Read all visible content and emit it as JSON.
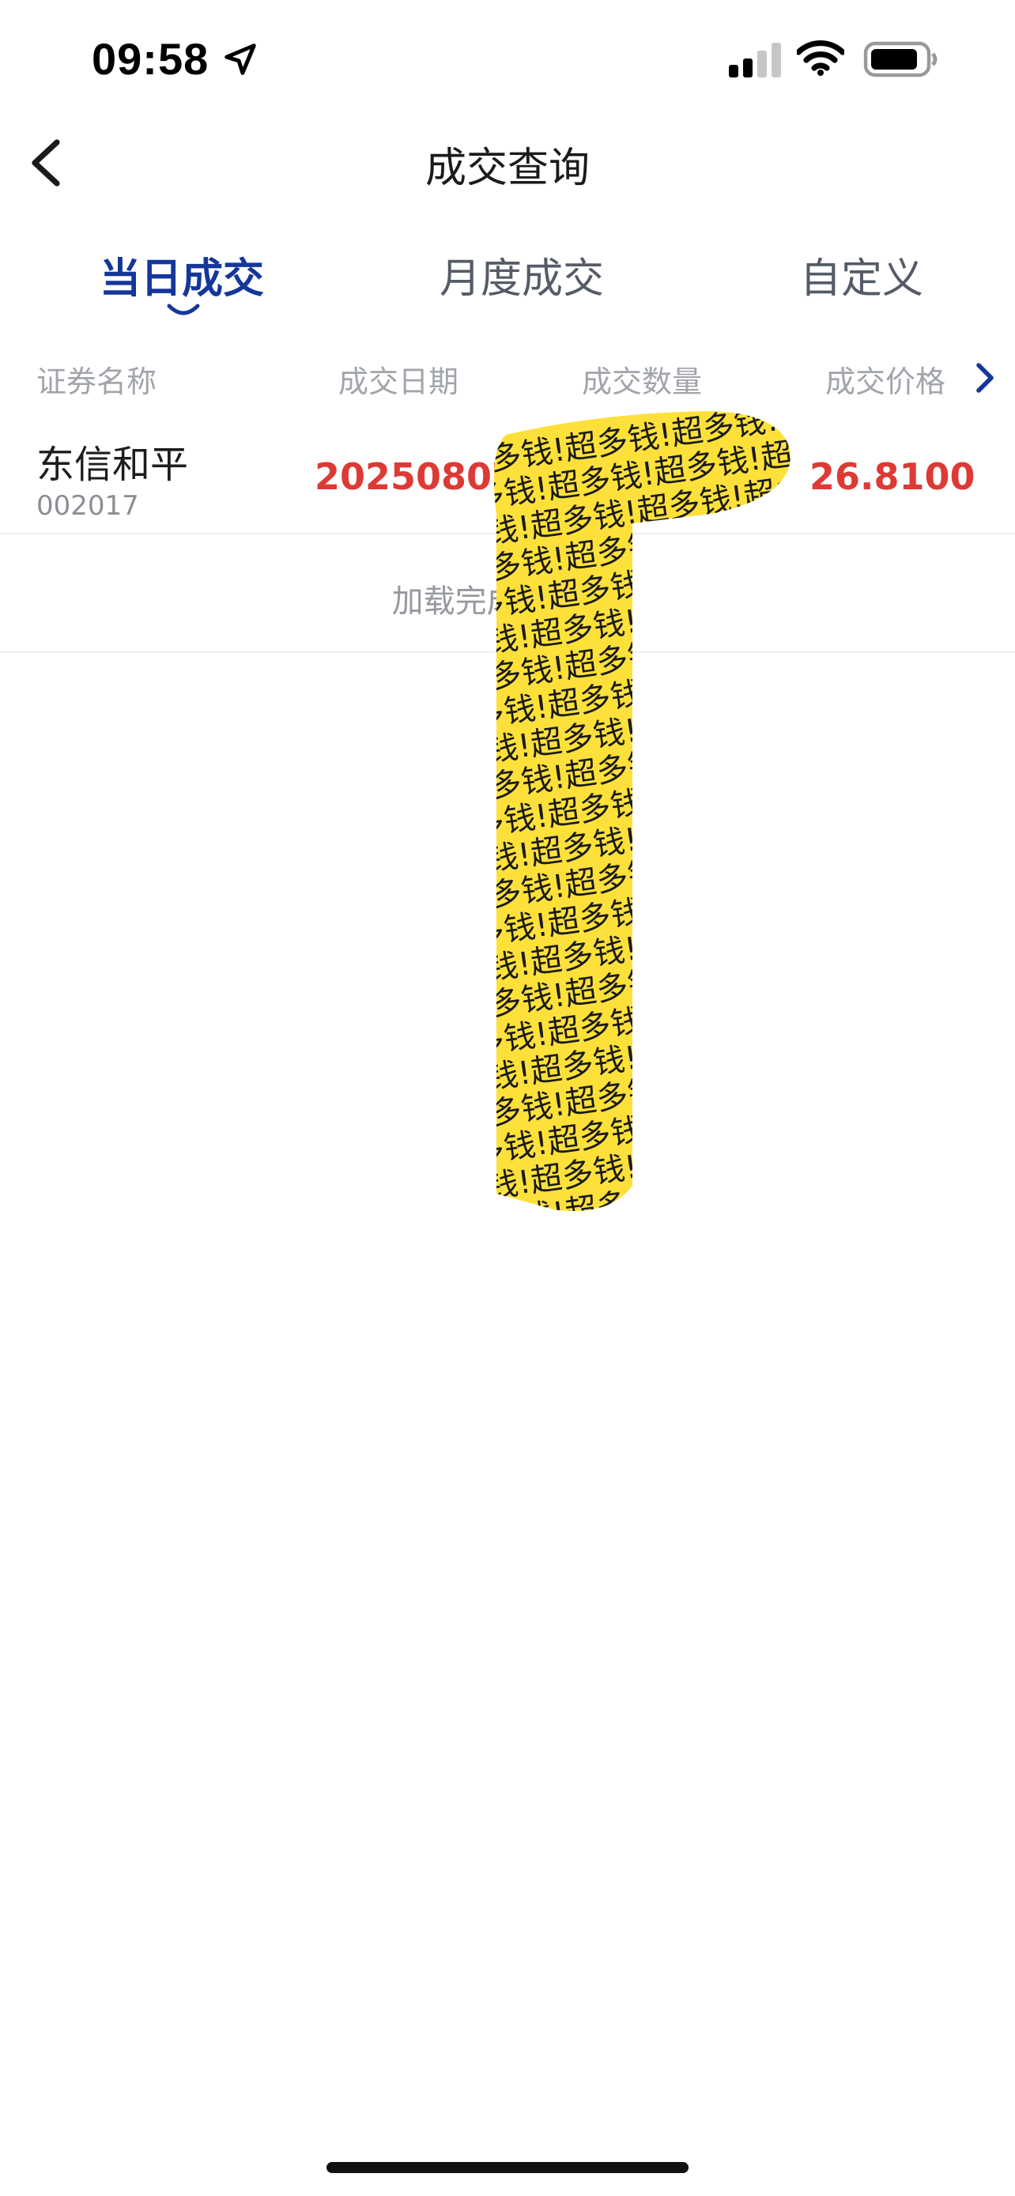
{
  "status_bar": {
    "time": "09:58"
  },
  "nav": {
    "title": "成交查询"
  },
  "tabs": [
    {
      "label": "当日成交",
      "active": true
    },
    {
      "label": "月度成交",
      "active": false
    },
    {
      "label": "自定义",
      "active": false
    }
  ],
  "table": {
    "headers": [
      "证券名称",
      "成交日期",
      "成交数量",
      "成交价格"
    ],
    "rows": [
      {
        "name": "东信和平",
        "code": "002017",
        "date": "20250807",
        "price": "26.8100"
      }
    ],
    "footer": "加载完成【 条】"
  },
  "sticker": {
    "text": "超多钱!"
  },
  "colors": {
    "accent": "#15379a",
    "value_red": "#dd3a35",
    "sticker_yellow": "#fde13a"
  }
}
